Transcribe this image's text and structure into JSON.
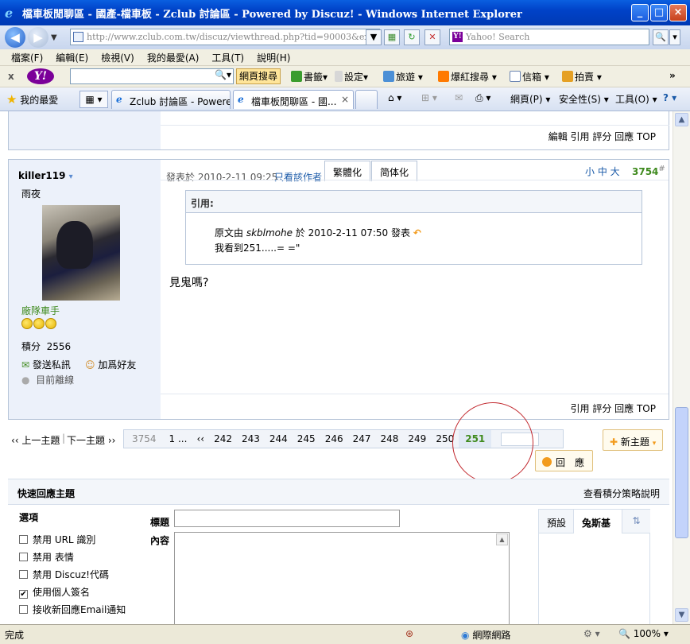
{
  "window": {
    "title": "檔車板閒聊區 - 國產-檔車板 - Zclub 討論區 - Powered by Discuz! - Windows Internet Explorer"
  },
  "address": {
    "url": "http://www.zclub.com.tw/discuz/viewthread.php?tid=90003&extra=&page",
    "search_placeholder": "Yahoo! Search"
  },
  "menu": [
    "檔案(F)",
    "編輯(E)",
    "檢視(V)",
    "我的最愛(A)",
    "工具(T)",
    "說明(H)"
  ],
  "ytoolbar": {
    "close": "x",
    "logo": "Y!",
    "search_btn": "網頁搜尋",
    "bookmarks": "書籤",
    "settings": "設定",
    "travel": "旅遊",
    "hot": "爆紅搜尋",
    "mail": "信箱",
    "auction": "拍賣",
    "more": "»"
  },
  "tabsbar": {
    "favorites": "我的最愛",
    "tabs": [
      {
        "label": "Zclub 討論區 - Powered..."
      },
      {
        "label": "檔車板閒聊區 - 國..."
      }
    ],
    "page_menu": "網頁(P)",
    "safety_menu": "安全性(S)",
    "tools_menu": "工具(O)"
  },
  "prev_post": {
    "actions": "編輯 引用 評分 回應 TOP"
  },
  "post": {
    "author": "killer119",
    "user_title": "雨夜",
    "rank": "廠隊車手",
    "points_label": "積分",
    "points": "2556",
    "pm": "發送私訊",
    "add_friend": "加爲好友",
    "status": "目前離線",
    "posted_at": "發表於 2010-2-11 09:25",
    "only_author": "只看該作者",
    "trad": "繁體化",
    "simp": "简体化",
    "font_sizes": "小 中 大",
    "floor": "3754",
    "floor_sup": "#",
    "quote_title": "引用:",
    "quote_prefix": "原文由",
    "quote_author": "skblmohe",
    "quote_suffix": "於 2010-2-11 07:50 發表",
    "quote_text": "我看到251.....=   =\"",
    "message": "見鬼嗎?",
    "actions": "引用 評分 回應 TOP"
  },
  "nav": {
    "prev_topic": "‹‹ 上一主題",
    "next_topic": "下一主題 ››",
    "pages": [
      "3754",
      "1 ...",
      "‹‹",
      "242",
      "243",
      "244",
      "245",
      "246",
      "247",
      "248",
      "249",
      "250",
      "251"
    ],
    "current_page": "251",
    "new_topic": "新主題",
    "reply": "回　應"
  },
  "quick_reply": {
    "title": "快速回應主題",
    "points_help": "查看積分策略說明",
    "options_label": "選項",
    "subject_label": "標題",
    "content_label": "內容",
    "options": [
      {
        "label": "禁用 URL 識別",
        "checked": false
      },
      {
        "label": "禁用 表情",
        "checked": false
      },
      {
        "label": "禁用 Discuz!代碼",
        "checked": false
      },
      {
        "label": "使用個人簽名",
        "checked": true
      },
      {
        "label": "接收新回應Email通知",
        "checked": false
      }
    ],
    "smiley_tabs": [
      "預設",
      "兔斯基"
    ]
  },
  "status": {
    "text": "完成",
    "zone": "網際網路",
    "zoom": "100%"
  },
  "colors": {
    "accent": "#0042c8",
    "highlight_green": "#3f8a1e",
    "link": "#1a5aa8",
    "circle": "#c1272d"
  }
}
